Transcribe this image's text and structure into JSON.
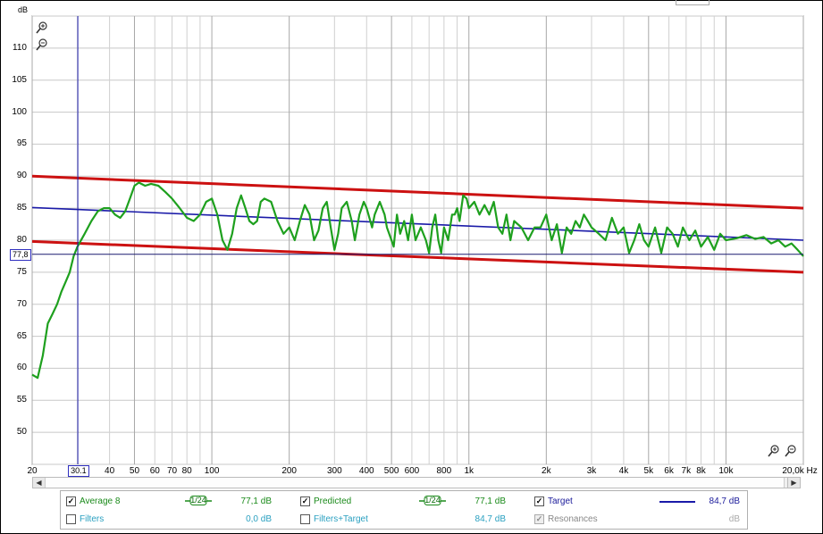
{
  "chart_data": {
    "type": "line",
    "ylabel": "dB",
    "xunit": "Hz",
    "x_scale": "log",
    "xlim": [
      20,
      20000
    ],
    "ylim": [
      45,
      115
    ],
    "yticks": [
      50,
      55,
      60,
      65,
      70,
      75,
      80,
      85,
      90,
      95,
      100,
      105,
      110
    ],
    "xticks": [
      {
        "v": 20,
        "label": "20"
      },
      {
        "v": 40,
        "label": "40"
      },
      {
        "v": 50,
        "label": "50"
      },
      {
        "v": 60,
        "label": "60"
      },
      {
        "v": 70,
        "label": "70"
      },
      {
        "v": 80,
        "label": "80"
      },
      {
        "v": 100,
        "label": "100"
      },
      {
        "v": 200,
        "label": "200"
      },
      {
        "v": 300,
        "label": "300"
      },
      {
        "v": 400,
        "label": "400"
      },
      {
        "v": 500,
        "label": "500"
      },
      {
        "v": 600,
        "label": "600"
      },
      {
        "v": 800,
        "label": "800"
      },
      {
        "v": 1000,
        "label": "1k"
      },
      {
        "v": 2000,
        "label": "2k"
      },
      {
        "v": 3000,
        "label": "3k"
      },
      {
        "v": 4000,
        "label": "4k"
      },
      {
        "v": 5000,
        "label": "5k"
      },
      {
        "v": 6000,
        "label": "6k"
      },
      {
        "v": 7000,
        "label": "7k"
      },
      {
        "v": 8000,
        "label": "8k"
      },
      {
        "v": 10000,
        "label": "10k"
      },
      {
        "v": 20000,
        "label": "20,0k Hz"
      }
    ],
    "cursor": {
      "x": 30.1,
      "x_label": "30.1",
      "y": 77.8,
      "y_label": "77,8"
    },
    "grid": true,
    "series": [
      {
        "name": "Average 8",
        "color": "#1ea01e",
        "points": [
          [
            20,
            59
          ],
          [
            21,
            58.5
          ],
          [
            22,
            62
          ],
          [
            23,
            67
          ],
          [
            24,
            68.5
          ],
          [
            25,
            70
          ],
          [
            26,
            72
          ],
          [
            27,
            73.5
          ],
          [
            28,
            75
          ],
          [
            29,
            77.5
          ],
          [
            30,
            79
          ],
          [
            32,
            81
          ],
          [
            34,
            83
          ],
          [
            36,
            84.5
          ],
          [
            38,
            85
          ],
          [
            40,
            85
          ],
          [
            42,
            84
          ],
          [
            44,
            83.5
          ],
          [
            46,
            84.5
          ],
          [
            48,
            86.5
          ],
          [
            50,
            88.5
          ],
          [
            52,
            89
          ],
          [
            55,
            88.5
          ],
          [
            58,
            88.8
          ],
          [
            62,
            88.5
          ],
          [
            66,
            87.5
          ],
          [
            70,
            86.5
          ],
          [
            75,
            85
          ],
          [
            80,
            83.5
          ],
          [
            85,
            83
          ],
          [
            90,
            84
          ],
          [
            95,
            86
          ],
          [
            100,
            86.5
          ],
          [
            105,
            84
          ],
          [
            110,
            80
          ],
          [
            115,
            78.5
          ],
          [
            120,
            81
          ],
          [
            125,
            85
          ],
          [
            130,
            87
          ],
          [
            135,
            85
          ],
          [
            140,
            83
          ],
          [
            145,
            82.5
          ],
          [
            150,
            83
          ],
          [
            155,
            86
          ],
          [
            160,
            86.5
          ],
          [
            170,
            86
          ],
          [
            180,
            83
          ],
          [
            190,
            81
          ],
          [
            200,
            82
          ],
          [
            210,
            80
          ],
          [
            220,
            83
          ],
          [
            230,
            85.5
          ],
          [
            240,
            84
          ],
          [
            250,
            80
          ],
          [
            260,
            81.5
          ],
          [
            270,
            85
          ],
          [
            280,
            86
          ],
          [
            290,
            82
          ],
          [
            300,
            78.5
          ],
          [
            310,
            81
          ],
          [
            320,
            85
          ],
          [
            335,
            86
          ],
          [
            350,
            83
          ],
          [
            360,
            80
          ],
          [
            375,
            84
          ],
          [
            390,
            86
          ],
          [
            400,
            85
          ],
          [
            420,
            82
          ],
          [
            430,
            84
          ],
          [
            450,
            86
          ],
          [
            470,
            84
          ],
          [
            480,
            82
          ],
          [
            500,
            80
          ],
          [
            510,
            79
          ],
          [
            525,
            84
          ],
          [
            540,
            81
          ],
          [
            560,
            83
          ],
          [
            580,
            80
          ],
          [
            600,
            84
          ],
          [
            620,
            80
          ],
          [
            650,
            82
          ],
          [
            680,
            80
          ],
          [
            700,
            78
          ],
          [
            720,
            82
          ],
          [
            740,
            84
          ],
          [
            760,
            80
          ],
          [
            780,
            78
          ],
          [
            800,
            82
          ],
          [
            830,
            80
          ],
          [
            860,
            84
          ],
          [
            880,
            84
          ],
          [
            900,
            85
          ],
          [
            920,
            83
          ],
          [
            950,
            87
          ],
          [
            980,
            86.5
          ],
          [
            1000,
            85
          ],
          [
            1050,
            86
          ],
          [
            1100,
            84
          ],
          [
            1150,
            85.5
          ],
          [
            1200,
            84
          ],
          [
            1250,
            86
          ],
          [
            1300,
            82
          ],
          [
            1350,
            81
          ],
          [
            1400,
            84
          ],
          [
            1450,
            80
          ],
          [
            1500,
            83
          ],
          [
            1600,
            82
          ],
          [
            1700,
            80
          ],
          [
            1800,
            82
          ],
          [
            1900,
            82
          ],
          [
            2000,
            84
          ],
          [
            2100,
            80
          ],
          [
            2200,
            82.5
          ],
          [
            2300,
            78
          ],
          [
            2400,
            82
          ],
          [
            2500,
            81
          ],
          [
            2600,
            83
          ],
          [
            2700,
            82
          ],
          [
            2800,
            84
          ],
          [
            2900,
            83
          ],
          [
            3000,
            82
          ],
          [
            3200,
            81
          ],
          [
            3400,
            80
          ],
          [
            3600,
            83.5
          ],
          [
            3800,
            81
          ],
          [
            4000,
            82
          ],
          [
            4200,
            78
          ],
          [
            4400,
            80
          ],
          [
            4600,
            82.5
          ],
          [
            4800,
            80
          ],
          [
            5000,
            79
          ],
          [
            5300,
            82
          ],
          [
            5600,
            78
          ],
          [
            5900,
            82
          ],
          [
            6200,
            81
          ],
          [
            6500,
            79
          ],
          [
            6800,
            82
          ],
          [
            7200,
            80
          ],
          [
            7600,
            81.5
          ],
          [
            8000,
            79
          ],
          [
            8500,
            80.5
          ],
          [
            9000,
            78.5
          ],
          [
            9500,
            81
          ],
          [
            10000,
            80
          ],
          [
            11000,
            80.3
          ],
          [
            12000,
            80.8
          ],
          [
            13000,
            80.2
          ],
          [
            14000,
            80.5
          ],
          [
            15000,
            79.5
          ],
          [
            16000,
            80
          ],
          [
            17000,
            79
          ],
          [
            18000,
            79.5
          ],
          [
            19000,
            78.5
          ],
          [
            20000,
            77.5
          ]
        ]
      },
      {
        "name": "Target",
        "color": "#1a1aa8",
        "points": [
          [
            20,
            85.1
          ],
          [
            20000,
            80
          ]
        ]
      },
      {
        "name": "Upper limit",
        "color": "#cc1111",
        "points": [
          [
            20,
            90
          ],
          [
            20000,
            85
          ]
        ]
      },
      {
        "name": "Lower limit",
        "color": "#cc1111",
        "points": [
          [
            20,
            79.8
          ],
          [
            20000,
            75
          ]
        ]
      }
    ]
  },
  "legend": {
    "rows": [
      [
        {
          "name": "Average 8",
          "color": "#1a8a1a",
          "checked": true,
          "disabled": false,
          "smoothing": "1/24",
          "value": "77,1 dB"
        },
        {
          "name": "Predicted",
          "color": "#1a8a1a",
          "checked": true,
          "disabled": false,
          "smoothing": "1/24",
          "value": "77,1 dB"
        },
        {
          "name": "Target",
          "color": "#1a1a9a",
          "checked": true,
          "disabled": false,
          "smoothing": "",
          "value": "84,7 dB"
        }
      ],
      [
        {
          "name": "Filters",
          "color": "#2aa0c0",
          "checked": false,
          "disabled": false,
          "smoothing": "",
          "value": "0,0 dB"
        },
        {
          "name": "Filters+Target",
          "color": "#2aa0c0",
          "checked": false,
          "disabled": false,
          "smoothing": "",
          "value": "84,7 dB"
        },
        {
          "name": "Resonances",
          "color": "#888888",
          "checked": true,
          "disabled": true,
          "smoothing": "",
          "value": "dB"
        }
      ]
    ]
  },
  "icons": {
    "zoom_in": "zoom-in-icon",
    "zoom_out": "zoom-out-icon",
    "scroll_left": "◀",
    "scroll_right": "▶"
  }
}
